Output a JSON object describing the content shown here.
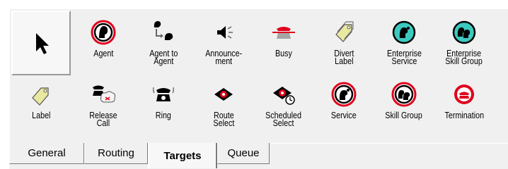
{
  "palette": {
    "row1": [
      {
        "label": "",
        "icon": "arrow-pointer-icon"
      },
      {
        "label": "Agent",
        "icon": "agent-icon"
      },
      {
        "label": "Agent to\nAgent",
        "icon": "agent-to-agent-icon"
      },
      {
        "label": "Announce-\nment",
        "icon": "announcement-icon"
      },
      {
        "label": "Busy",
        "icon": "busy-phone-icon"
      },
      {
        "label": "Divert\nLabel",
        "icon": "divert-label-icon"
      },
      {
        "label": "Enterprise\nService",
        "icon": "enterprise-service-icon"
      },
      {
        "label": "Enterprise\nSkill Group",
        "icon": "enterprise-skill-group-icon"
      }
    ],
    "row2": [
      {
        "label": "Label",
        "icon": "label-tag-icon"
      },
      {
        "label": "Release\nCall",
        "icon": "release-call-icon"
      },
      {
        "label": "Ring",
        "icon": "ring-phone-icon"
      },
      {
        "label": "Route\nSelect",
        "icon": "route-select-icon"
      },
      {
        "label": "Scheduled\nSelect",
        "icon": "scheduled-select-icon"
      },
      {
        "label": "Service",
        "icon": "service-icon"
      },
      {
        "label": "Skill Group",
        "icon": "skill-group-icon"
      },
      {
        "label": "Termination",
        "icon": "termination-icon"
      }
    ]
  },
  "tabs": [
    {
      "label": "General",
      "active": false
    },
    {
      "label": "Routing",
      "active": false
    },
    {
      "label": "Targets",
      "active": true
    },
    {
      "label": "Queue",
      "active": false
    }
  ],
  "colors": {
    "accent_red": "#e0001b",
    "teal": "#3cc9c0",
    "panel": "#f0f0f0"
  }
}
